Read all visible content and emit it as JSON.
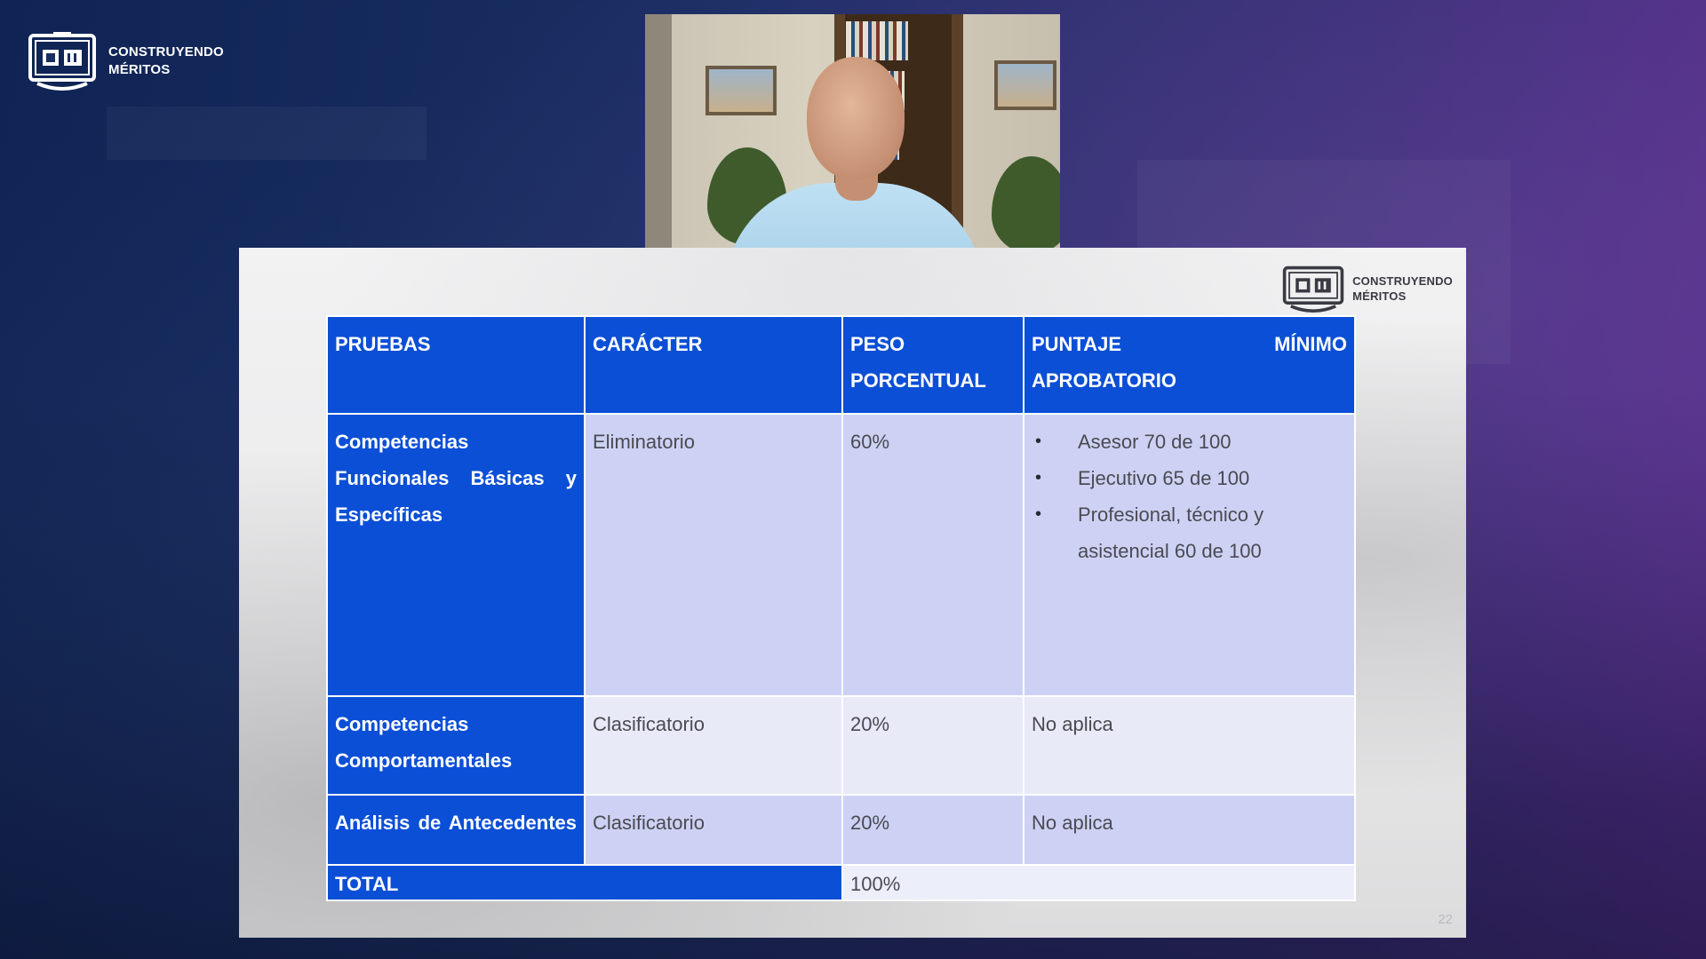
{
  "brand": {
    "line1": "CONSTRUYENDO",
    "line2": "MÉRITOS",
    "logo_icon": "book-cm-logo-icon"
  },
  "webcam": {
    "subject": "presenter-video"
  },
  "slide": {
    "brand": {
      "line1": "CONSTRUYENDO",
      "line2": "MÉRITOS"
    },
    "page_number": "22",
    "table": {
      "headers": {
        "pruebas": "PRUEBAS",
        "caracter": "CARÁCTER",
        "peso": "PESO PORCENTUAL",
        "puntaje_a": "PUNTAJE",
        "puntaje_b": "MÍNIMO",
        "puntaje_c": "APROBATORIO"
      },
      "rows": [
        {
          "prueba": "Competencias Funcionales Básicas y Específicas",
          "caracter": "Eliminatorio",
          "peso": "60%",
          "puntaje_items": [
            "Asesor 70 de 100",
            "Ejecutivo 65 de 100",
            "Profesional, técnico y asistencial 60 de 100"
          ]
        },
        {
          "prueba": "Competencias Comportamentales",
          "caracter": "Clasificatorio",
          "peso": "20%",
          "puntaje": "No aplica"
        },
        {
          "prueba": "Análisis de Antecedentes",
          "caracter": "Clasificatorio",
          "peso": "20%",
          "puntaje": "No aplica"
        }
      ],
      "total": {
        "label": "TOTAL",
        "value": "100%"
      }
    }
  },
  "colors": {
    "header_blue": "#0b4fd6",
    "row_lilac": "#cdd2f4",
    "row_light": "#e8eaf8"
  }
}
